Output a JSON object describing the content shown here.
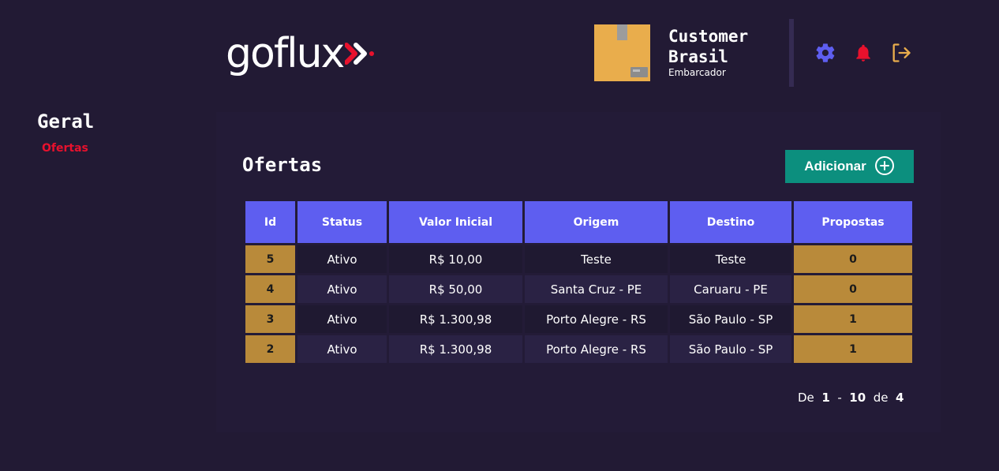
{
  "brand": {
    "name": "goflux"
  },
  "user": {
    "name": "Customer Brasil",
    "role": "Embarcador"
  },
  "header_icons": {
    "settings": "gear-icon",
    "notifications": "bell-icon",
    "logout": "logout-icon"
  },
  "colors": {
    "accent": "#5e5ef0",
    "brand_red": "#e8112d",
    "button_green": "#0c8f7e",
    "gold": "#b98a3a",
    "background": "#221a34"
  },
  "sidebar": {
    "section": "Geral",
    "items": [
      {
        "label": "Ofertas",
        "active": true
      }
    ]
  },
  "main": {
    "title": "Ofertas",
    "add_button": "Adicionar",
    "table": {
      "columns": [
        "Id",
        "Status",
        "Valor Inicial",
        "Origem",
        "Destino",
        "Propostas"
      ],
      "rows": [
        {
          "id": "5",
          "status": "Ativo",
          "valor": "R$ 10,00",
          "origem": "Teste",
          "destino": "Teste",
          "propostas": "0"
        },
        {
          "id": "4",
          "status": "Ativo",
          "valor": "R$ 50,00",
          "origem": "Santa Cruz - PE",
          "destino": "Caruaru - PE",
          "propostas": "0"
        },
        {
          "id": "3",
          "status": "Ativo",
          "valor": "R$ 1.300,98",
          "origem": "Porto Alegre - RS",
          "destino": "São Paulo - SP",
          "propostas": "1"
        },
        {
          "id": "2",
          "status": "Ativo",
          "valor": "R$ 1.300,98",
          "origem": "Porto Alegre - RS",
          "destino": "São Paulo - SP",
          "propostas": "1"
        }
      ]
    },
    "pagination": {
      "prefix": "De",
      "from": "1",
      "sep": "-",
      "to": "10",
      "of_label": "de",
      "total": "4"
    }
  }
}
